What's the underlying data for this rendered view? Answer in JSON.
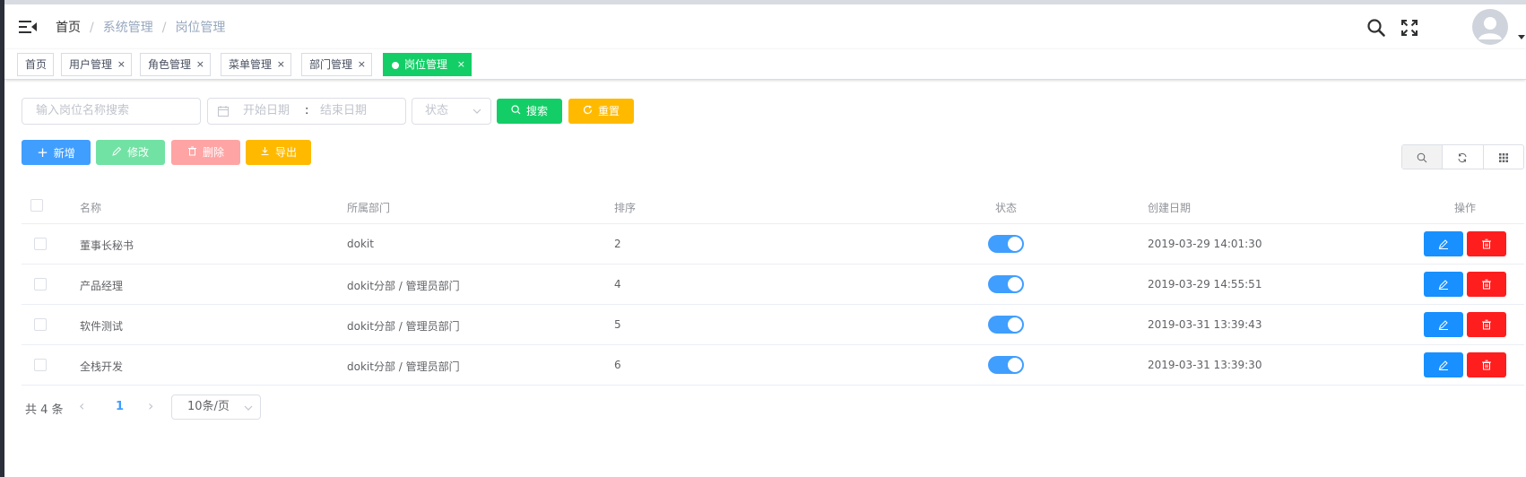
{
  "breadcrumb": {
    "home": "首页",
    "sep": "/",
    "level1": "系统管理",
    "level2": "岗位管理"
  },
  "navbar": {
    "icons": [
      "menu-icon",
      "search-icon",
      "fullscreen-icon",
      "user-avatar-icon"
    ]
  },
  "tags": [
    {
      "label": "首页",
      "closable": false,
      "active": false
    },
    {
      "label": "用户管理",
      "closable": true,
      "active": false
    },
    {
      "label": "角色管理",
      "closable": true,
      "active": false
    },
    {
      "label": "菜单管理",
      "closable": true,
      "active": false
    },
    {
      "label": "部门管理",
      "closable": true,
      "active": false
    },
    {
      "label": "岗位管理",
      "closable": true,
      "active": true
    }
  ],
  "tag_close": "×",
  "search": {
    "name_placeholder": "输入岗位名称搜索",
    "start_date_placeholder": "开始日期",
    "range_separator": ":",
    "end_date_placeholder": "结束日期",
    "status_placeholder": "状态",
    "search_label": "搜索",
    "reset_label": "重置"
  },
  "toolbar": {
    "add_label": "新增",
    "edit_label": "修改",
    "delete_label": "删除",
    "export_label": "导出"
  },
  "table": {
    "headers": {
      "name": "名称",
      "dept": "所属部门",
      "sort": "排序",
      "status": "状态",
      "created": "创建日期",
      "ops": "操作"
    },
    "rows": [
      {
        "name": "董事长秘书",
        "dept": "dokit",
        "sort": "2",
        "enabled": true,
        "created": "2019-03-29 14:01:30"
      },
      {
        "name": "产品经理",
        "dept": "dokit分部 / 管理员部门",
        "sort": "4",
        "enabled": true,
        "created": "2019-03-29 14:55:51"
      },
      {
        "name": "软件测试",
        "dept": "dokit分部 / 管理员部门",
        "sort": "5",
        "enabled": true,
        "created": "2019-03-31 13:39:43"
      },
      {
        "name": "全栈开发",
        "dept": "dokit分部 / 管理员部门",
        "sort": "6",
        "enabled": true,
        "created": "2019-03-31 13:39:30"
      }
    ]
  },
  "pagination": {
    "total_text": "共 4 条",
    "prev": "‹",
    "current_page": "1",
    "next": "›",
    "page_size": "10条/页"
  },
  "colors": {
    "primary": "#409eff",
    "success": "#13ce66",
    "warning": "#ffba00",
    "danger": "#ff4949",
    "edit_light": "#71e2a3",
    "delete_light": "#ffa4a4",
    "op_edit": "#1890ff",
    "op_delete": "#ff1e1e"
  }
}
